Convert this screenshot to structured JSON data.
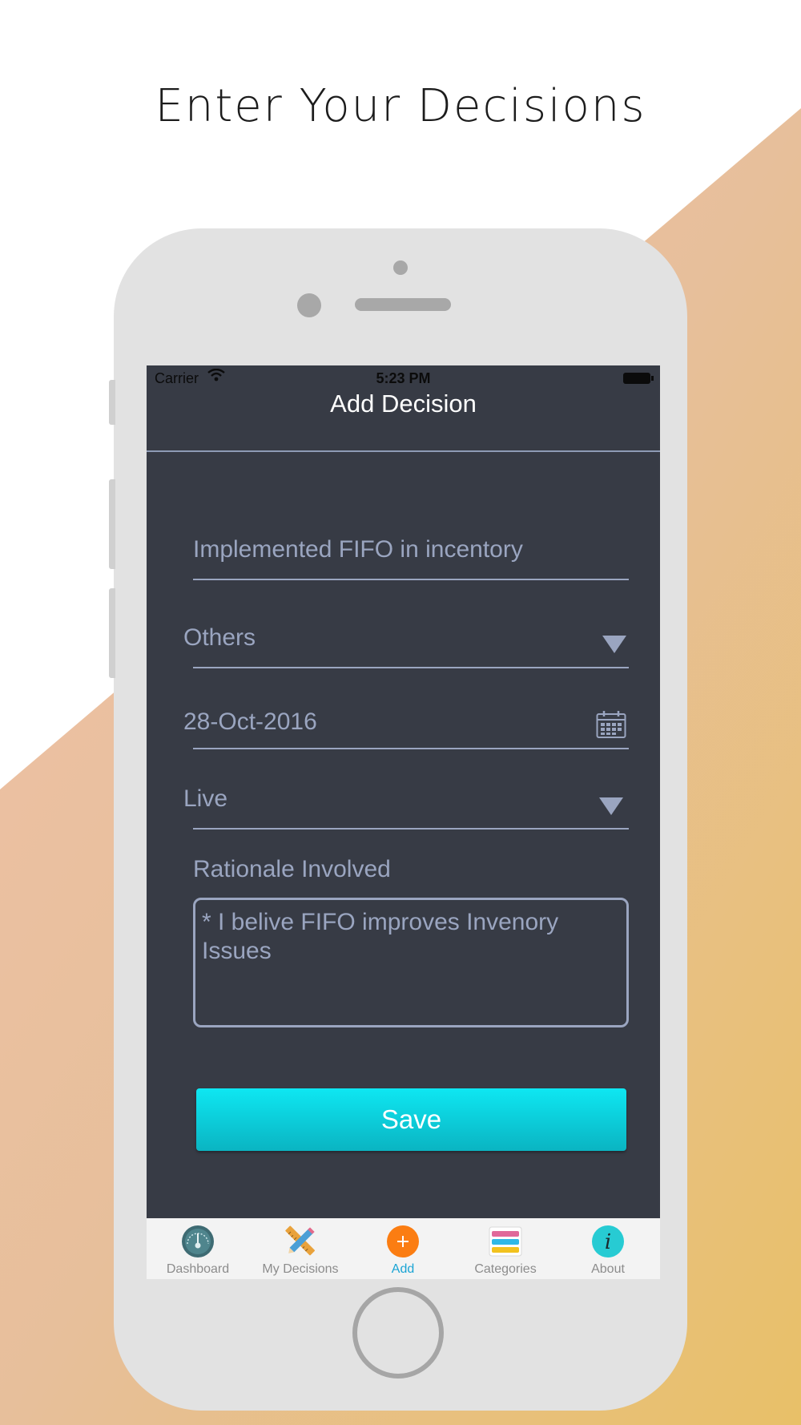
{
  "headline": "Enter Your Decisions",
  "colors": {
    "screen_bg": "#373b45",
    "field_text": "#9aa5c0",
    "save_button": "#0ee7f2",
    "tab_active": "#1aa4d4",
    "bg_gradient_start": "#f0c2a8",
    "bg_gradient_end": "#e8c068"
  },
  "status_bar": {
    "carrier": "Carrier",
    "time": "5:23 PM"
  },
  "navbar": {
    "title": "Add Decision"
  },
  "form": {
    "decision_title": "Implemented FIFO in incentory",
    "category": "Others",
    "date": "28-Oct-2016",
    "status": "Live",
    "rationale_label": "Rationale Involved",
    "rationale_text": "* I belive FIFO improves Invenory Issues",
    "save_label": "Save"
  },
  "tabbar": {
    "items": [
      {
        "label": "Dashboard",
        "icon": "gauge-icon",
        "active": false
      },
      {
        "label": "My Decisions",
        "icon": "pencil-ruler-icon",
        "active": false
      },
      {
        "label": "Add",
        "icon": "plus-circle-icon",
        "active": true
      },
      {
        "label": "Categories",
        "icon": "stacked-list-icon",
        "active": false
      },
      {
        "label": "About",
        "icon": "info-icon",
        "active": false
      }
    ]
  }
}
